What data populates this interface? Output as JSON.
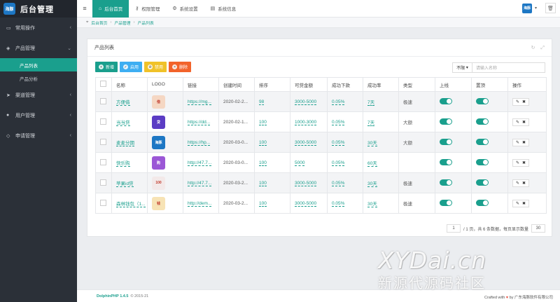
{
  "brand": {
    "logo_text": "海豚",
    "title": "后台管理"
  },
  "sidebar": {
    "items": [
      {
        "label": "常用操作"
      },
      {
        "label": "产品管理"
      },
      {
        "label": "渠道管理"
      },
      {
        "label": "用户管理"
      },
      {
        "label": "申请管理"
      }
    ],
    "subitems": [
      {
        "label": "产品列表"
      },
      {
        "label": "产品分析"
      }
    ]
  },
  "topbar": {
    "tabs": [
      {
        "label": "后台首页"
      },
      {
        "label": "权限管理"
      },
      {
        "label": "系统设置"
      },
      {
        "label": "系统信息"
      }
    ],
    "avatar_text": "海豚"
  },
  "breadcrumb": {
    "items": [
      "后台首页",
      "产品管理",
      "产品列表"
    ]
  },
  "card": {
    "title": "产品列表"
  },
  "toolbar": {
    "add": "新增",
    "enable": "启用",
    "disable": "禁用",
    "delete": "删除"
  },
  "search": {
    "select_value": "不限",
    "placeholder": "请输入名称"
  },
  "table": {
    "headers": [
      "名称",
      "LOGO",
      "链接",
      "创建时间",
      "排序",
      "可贷金额",
      "成功下款",
      "成功率",
      "类型",
      "上线",
      "置顶",
      "操作"
    ],
    "rows": [
      {
        "name": "方便借",
        "logo_text": "借",
        "logo_color": "#f5d7c3",
        "link": "https://mg...",
        "created": "2020-02-2...",
        "sort": "98",
        "amount": "3000-5000",
        "rate": "0.05%",
        "term": "7天",
        "type": "极速"
      },
      {
        "name": "当当贷",
        "logo_text": "贷",
        "logo_color": "#5b3cc4",
        "link": "https://dd...",
        "created": "2020-02-1...",
        "sort": "100",
        "amount": "1000-3000",
        "rate": "0.05%",
        "term": "7天",
        "type": "大额"
      },
      {
        "name": "麦麦分期",
        "logo_text": "海豚",
        "logo_color": "#1d77c4",
        "link": "https://hp...",
        "created": "2020-03-0...",
        "sort": "100",
        "amount": "3000-5000",
        "rate": "0.05%",
        "term": "30天",
        "type": "大额"
      },
      {
        "name": "快乐购",
        "logo_text": "购",
        "logo_color": "#9b57d6",
        "link": "http://47.7...",
        "created": "2020-03-0...",
        "sort": "100",
        "amount": "5000",
        "rate": "0.05%",
        "term": "60天",
        "type": ""
      },
      {
        "name": "苹果id贷",
        "logo_text": "100",
        "logo_color": "#f3e9e9",
        "link": "http://47.7...",
        "created": "2020-03-2...",
        "sort": "100",
        "amount": "3000-5000",
        "rate": "0.05%",
        "term": "30天",
        "type": "极速"
      },
      {
        "name": "森林钱包（1...",
        "logo_text": "钱",
        "logo_color": "#f7e3b5",
        "link": "http://dem...",
        "created": "2020-03-2...",
        "sort": "100",
        "amount": "3000-5000",
        "rate": "0.05%",
        "term": "30天",
        "type": "极速"
      }
    ]
  },
  "pager": {
    "current_page": "1",
    "summary": "/ 1 页，共 6 条数据，每页显示数量",
    "per_page": "30"
  },
  "footer": {
    "brand": "DolphinPHP 1.4.5",
    "copyright": "© 2015-21",
    "crafted": "Crafted with",
    "by": "by 广东海豚软件有限公司"
  },
  "watermark": {
    "line1": "XYDai.cn",
    "line2": "新源代源码社区"
  },
  "colors": {
    "accent": "#1a9f8d",
    "sidebar_bg": "#2b3038",
    "blue": "#3eaef2",
    "yellow": "#f0c229",
    "orange": "#f2632b"
  }
}
